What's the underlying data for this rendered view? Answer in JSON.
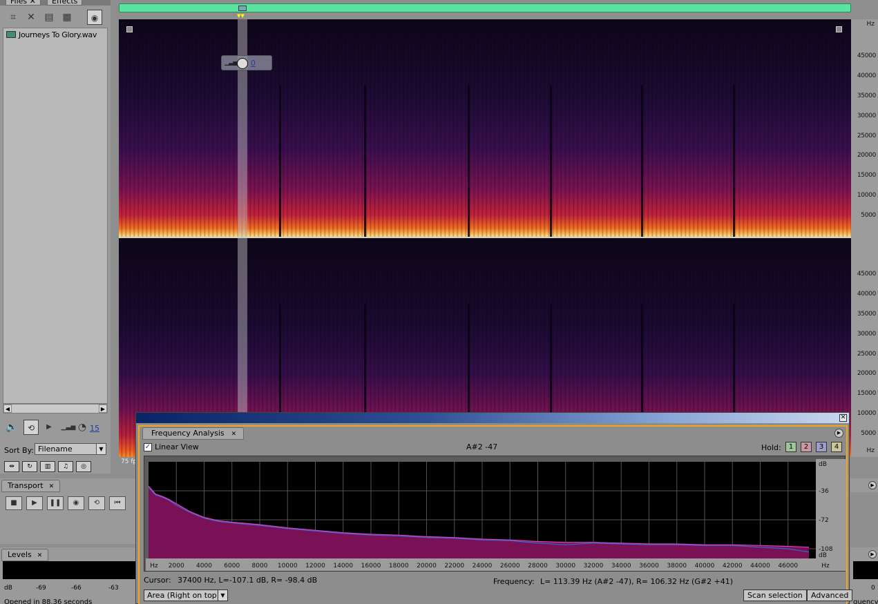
{
  "files_panel": {
    "tabs": [
      "Files",
      "Effects"
    ],
    "items": [
      {
        "name": "Journeys To Glory.wav"
      }
    ],
    "volume_value": "15",
    "sort_label": "Sort By:",
    "sort_value": "Filename"
  },
  "editor": {
    "volume_hud_value": "0",
    "fps_label": "75 fp",
    "hz_unit": "Hz",
    "hz_ticks_upper": [
      "45000",
      "40000",
      "35000",
      "30000",
      "25000",
      "20000",
      "15000",
      "10000",
      "5000"
    ],
    "hz_ticks_lower": [
      "45000",
      "40000",
      "35000",
      "30000",
      "25000",
      "20000",
      "15000",
      "10000",
      "5000"
    ]
  },
  "transport": {
    "tab_label": "Transport"
  },
  "levels": {
    "tab_label": "Levels",
    "ticks": [
      "dB",
      "-69",
      "-66",
      "-63"
    ],
    "status": "Opened in 88.36 seconds",
    "right_zero": "0",
    "right_partial": "quency"
  },
  "frequency_analysis": {
    "tab_label": "Frequency Analysis",
    "linear_view_label": "Linear View",
    "linear_view_checked": true,
    "note_readout": "A#2 -47",
    "hold_label": "Hold:",
    "hold_buttons": [
      "1",
      "2",
      "3",
      "4"
    ],
    "hold_colors": [
      "#9fc59b",
      "#c79aa3",
      "#9f9bc9",
      "#c9c79a"
    ],
    "cursor_label": "Cursor:",
    "cursor_value": "37400 Hz, L=-107.1 dB, R= -98.4 dB",
    "frequency_label": "Frequency:",
    "frequency_value": "L= 113.39 Hz (A#2 -47), R= 106.32 Hz (G#2 +41)",
    "graph_type": "Area (Right on top)",
    "scan_button": "Scan selection",
    "advanced_button": "Advanced",
    "colors": {
      "left_fill": "#7a1055",
      "left_line": "#e040c0",
      "right_line": "#2e6cd0"
    }
  },
  "chart_data": {
    "type": "area",
    "x_unit": "Hz",
    "y_unit": "dB",
    "x_ticks": [
      2000,
      4000,
      6000,
      8000,
      10000,
      12000,
      14000,
      16000,
      18000,
      20000,
      22000,
      24000,
      26000,
      28000,
      30000,
      32000,
      34000,
      36000,
      38000,
      40000,
      42000,
      44000,
      46000
    ],
    "y_ticks": [
      -36,
      -72,
      -108
    ],
    "xlim": [
      0,
      48000
    ],
    "ylim": [
      -120,
      0
    ],
    "grid": true,
    "series": [
      {
        "x": [
          0,
          500,
          1000,
          1500,
          2000,
          3000,
          4000,
          5000,
          6000,
          8000,
          10000,
          12000,
          14000,
          16000,
          18000,
          20000,
          22000,
          24000,
          26000,
          28000,
          30000,
          32000,
          34000,
          36000,
          38000,
          40000,
          42000,
          44000,
          46000,
          47500
        ],
        "y": [
          -30,
          -40,
          -43,
          -47,
          -52,
          -62,
          -69,
          -73,
          -75,
          -78,
          -82,
          -85,
          -88,
          -90,
          -91,
          -93,
          -94,
          -96,
          -97,
          -99,
          -100,
          -100,
          -101,
          -102,
          -102,
          -103,
          -103,
          -104,
          -105,
          -106
        ]
      },
      {
        "x": [
          0,
          500,
          1000,
          1500,
          2000,
          3000,
          4000,
          5000,
          6000,
          8000,
          10000,
          12000,
          14000,
          16000,
          18000,
          20000,
          22000,
          24000,
          26000,
          28000,
          30000,
          32000,
          34000,
          36000,
          38000,
          40000,
          42000,
          44000,
          46000,
          47500
        ],
        "y": [
          -32,
          -41,
          -44,
          -48,
          -54,
          -63,
          -70,
          -74,
          -76,
          -79,
          -83,
          -86,
          -89,
          -91,
          -92,
          -94,
          -95,
          -97,
          -98,
          -101,
          -103,
          -101,
          -102,
          -103,
          -103,
          -104,
          -104,
          -106,
          -108,
          -112
        ]
      }
    ]
  }
}
